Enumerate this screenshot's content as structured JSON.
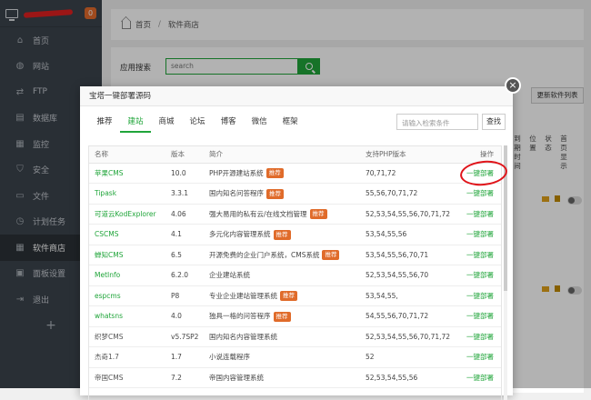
{
  "sidebar": {
    "badge": "0",
    "items": [
      {
        "icon": "home-icon",
        "glyph": "⌂",
        "label": "首页"
      },
      {
        "icon": "globe-icon",
        "glyph": "◍",
        "label": "网站"
      },
      {
        "icon": "ftp-icon",
        "glyph": "⇄",
        "label": "FTP"
      },
      {
        "icon": "database-icon",
        "glyph": "▤",
        "label": "数据库"
      },
      {
        "icon": "monitor-icon",
        "glyph": "▦",
        "label": "监控"
      },
      {
        "icon": "shield-icon",
        "glyph": "⛉",
        "label": "安全"
      },
      {
        "icon": "folder-icon",
        "glyph": "▭",
        "label": "文件"
      },
      {
        "icon": "clock-icon",
        "glyph": "◷",
        "label": "计划任务"
      },
      {
        "icon": "grid-icon",
        "glyph": "▦",
        "label": "软件商店"
      },
      {
        "icon": "settings-icon",
        "glyph": "▣",
        "label": "面板设置"
      },
      {
        "icon": "logout-icon",
        "glyph": "⇥",
        "label": "退出"
      }
    ],
    "plus": "+"
  },
  "breadcrumb": {
    "home": "首页",
    "sep": "/",
    "current": "软件商店"
  },
  "store": {
    "search_label": "应用搜索",
    "search_value": "search",
    "update_list": "更新软件列表",
    "bg_cols": [
      "到期时间",
      "位置",
      "状态",
      "首页显示"
    ]
  },
  "modal": {
    "title": "宝塔一键部署源码",
    "close": "×",
    "tabs": [
      "推荐",
      "建站",
      "商城",
      "论坛",
      "博客",
      "微信",
      "框架"
    ],
    "active_tab": 1,
    "search_placeholder": "请输入检索条件",
    "search_button": "查找",
    "columns": [
      "名称",
      "版本",
      "简介",
      "支持PHP版本",
      "操作"
    ],
    "recommend": "推荐",
    "deploy": "一键部署",
    "rows": [
      {
        "name": "苹果CMS",
        "version": "10.0",
        "intro": "PHP开源建站系统",
        "rec": true,
        "php": "70,71,72",
        "green": true
      },
      {
        "name": "Tipask",
        "version": "3.3.1",
        "intro": "国内知名问答程序",
        "rec": true,
        "php": "55,56,70,71,72",
        "green": true
      },
      {
        "name": "可道云KodExplorer",
        "version": "4.06",
        "intro": "强大易用的私有云/在线文档管理",
        "rec": true,
        "php": "52,53,54,55,56,70,71,72",
        "green": true
      },
      {
        "name": "CSCMS",
        "version": "4.1",
        "intro": "多元化内容管理系统",
        "rec": true,
        "php": "53,54,55,56",
        "green": true
      },
      {
        "name": "蝉知CMS",
        "version": "6.5",
        "intro": "开源免费的企业门户系统，CMS系统",
        "rec": true,
        "php": "53,54,55,56,70,71",
        "green": true
      },
      {
        "name": "MetInfo",
        "version": "6.2.0",
        "intro": "企业建站系统",
        "rec": false,
        "php": "52,53,54,55,56,70",
        "green": true
      },
      {
        "name": "espcms",
        "version": "P8",
        "intro": "专业企业建站管理系统",
        "rec": true,
        "php": "53,54,55,",
        "green": true
      },
      {
        "name": "whatsns",
        "version": "4.0",
        "intro": "独具一格的问答程序",
        "rec": true,
        "php": "54,55,56,70,71,72",
        "green": true
      },
      {
        "name": "织梦CMS",
        "version": "v5.7SP2",
        "intro": "国内知名内容管理系统",
        "rec": false,
        "php": "52,53,54,55,56,70,71,72",
        "green": false
      },
      {
        "name": "杰奇1.7",
        "version": "1.7",
        "intro": "小说连载程序",
        "rec": false,
        "php": "52",
        "green": false
      },
      {
        "name": "帝国CMS",
        "version": "7.2",
        "intro": "帝国内容管理系统",
        "rec": false,
        "php": "52,53,54,55,56",
        "green": false
      }
    ]
  },
  "colors": {
    "accent": "#20a53a",
    "recommend": "#e06b2a",
    "sidebar": "#3c444d",
    "annotation": "#e0141a"
  }
}
